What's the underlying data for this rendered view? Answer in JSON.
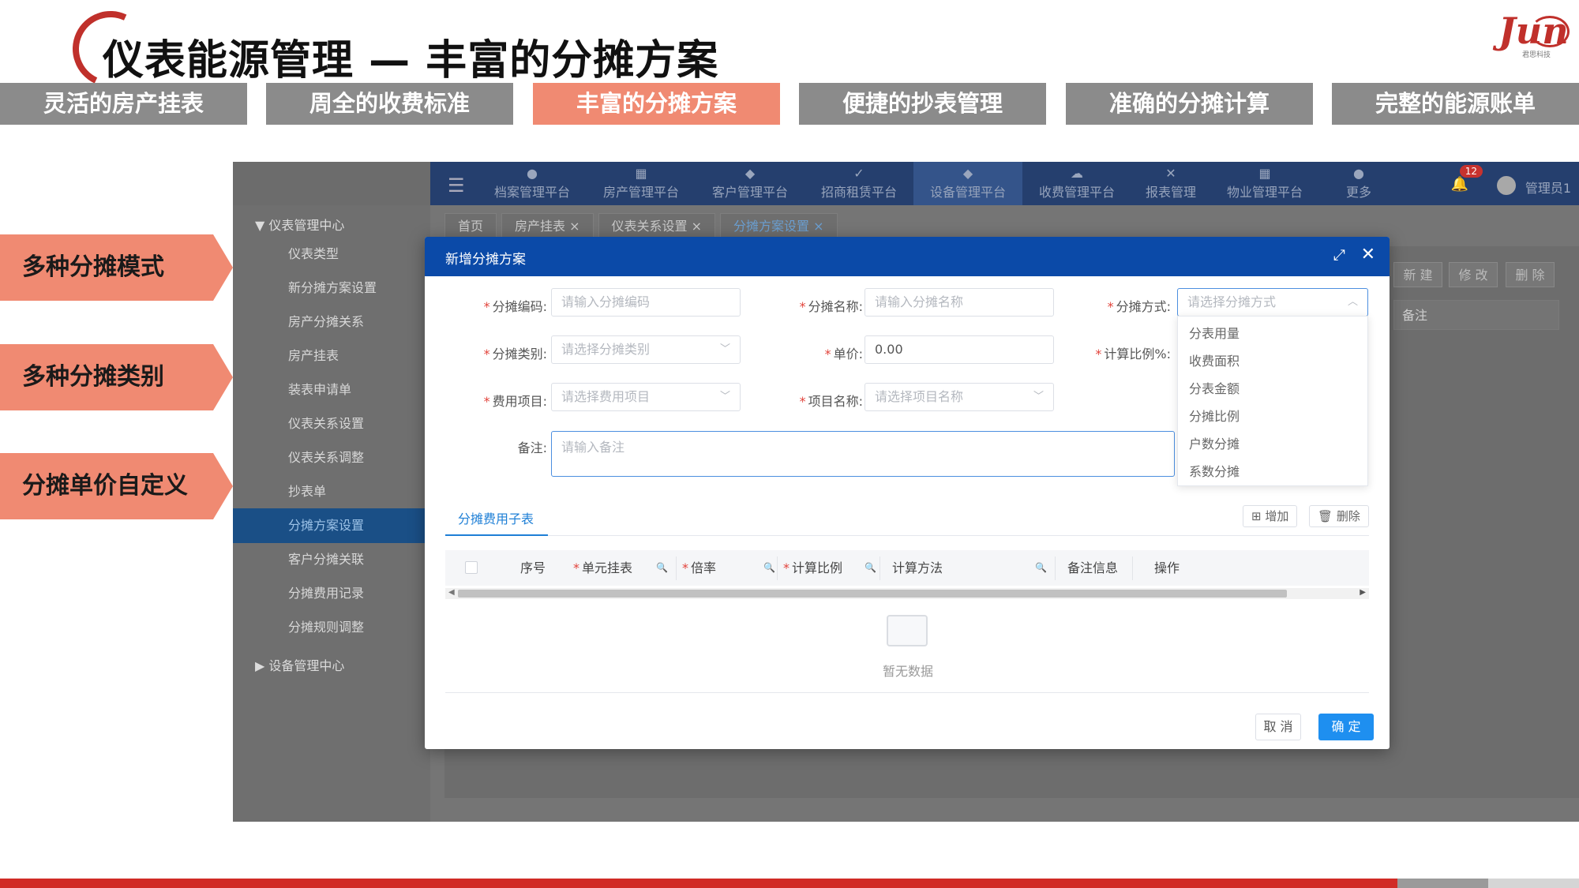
{
  "slide": {
    "title": "仪表能源管理 — 丰富的分摊方案",
    "logo_text": "Jun",
    "logo_sub": "君思科技",
    "nav": [
      {
        "label": "灵活的房产挂表"
      },
      {
        "label": "周全的收费标准"
      },
      {
        "label": "丰富的分摊方案",
        "active": true
      },
      {
        "label": "便捷的抄表管理"
      },
      {
        "label": "准确的分摊计算"
      },
      {
        "label": "完整的能源账单"
      }
    ],
    "callouts": [
      "多种分摊模式",
      "多种分摊类别",
      "分摊单价自定义"
    ],
    "colors": {
      "accent": "#f08a72",
      "tab_gray": "#8b8b8b",
      "brand_red": "#d12b26",
      "primary_blue": "#1e8ff0"
    }
  },
  "app": {
    "top_nav": [
      {
        "label": "档案管理平台",
        "icon": "archive-icon"
      },
      {
        "label": "房产管理平台",
        "icon": "building-icon"
      },
      {
        "label": "客户管理平台",
        "icon": "customer-icon"
      },
      {
        "label": "招商租赁平台",
        "icon": "check-icon"
      },
      {
        "label": "设备管理平台",
        "icon": "device-icon",
        "active": true
      },
      {
        "label": "收费管理平台",
        "icon": "charge-icon"
      },
      {
        "label": "报表管理",
        "icon": "report-icon"
      },
      {
        "label": "物业管理平台",
        "icon": "property-icon"
      },
      {
        "label": "更多",
        "icon": "more-icon"
      }
    ],
    "notification_count": "12",
    "user": "管理员1",
    "sidebar": {
      "group1": "仪表管理中心",
      "items": [
        "仪表类型",
        "新分摊方案设置",
        "房产分摊关系",
        "房产挂表",
        "装表申请单",
        "仪表关系设置",
        "仪表关系调整",
        "抄表单",
        "分摊方案设置",
        "客户分摊关联",
        "分摊费用记录",
        "分摊规则调整"
      ],
      "active_index": 8,
      "group2": "设备管理中心"
    },
    "tabs": [
      {
        "label": "首页"
      },
      {
        "label": "房产挂表 ×"
      },
      {
        "label": "仪表关系设置 ×"
      },
      {
        "label": "分摊方案设置 ×",
        "active": true
      }
    ],
    "bg_buttons": [
      "新 建",
      "修 改",
      "删 除"
    ],
    "bg_remark_label": "备注"
  },
  "modal": {
    "title": "新增分摊方案",
    "fields": {
      "code": {
        "label": "分摊编码:",
        "placeholder": "请输入分摊编码"
      },
      "name": {
        "label": "分摊名称:",
        "placeholder": "请输入分摊名称"
      },
      "method": {
        "label": "分摊方式:",
        "placeholder": "请选择分摊方式"
      },
      "category": {
        "label": "分摊类别:",
        "placeholder": "请选择分摊类别"
      },
      "price": {
        "label": "单价:",
        "value": "0.00"
      },
      "ratio": {
        "label": "计算比例%:"
      },
      "fee_item": {
        "label": "费用项目:",
        "placeholder": "请选择费用项目"
      },
      "project": {
        "label": "项目名称:",
        "placeholder": "请选择项目名称"
      },
      "remark": {
        "label": "备注:",
        "placeholder": "请输入备注"
      }
    },
    "method_options": [
      "分表用量",
      "收费面积",
      "分表金额",
      "分摊比例",
      "户数分摊",
      "系数分摊"
    ],
    "subtab": "分摊费用子表",
    "add_label": "增加",
    "delete_label": "删除",
    "columns": [
      {
        "label": "序号"
      },
      {
        "label": "单元挂表",
        "required": true
      },
      {
        "label": "倍率",
        "required": true
      },
      {
        "label": "计算比例",
        "required": true
      },
      {
        "label": "计算方法"
      },
      {
        "label": "备注信息"
      },
      {
        "label": "操作"
      }
    ],
    "empty_text": "暂无数据",
    "cancel_label": "取 消",
    "ok_label": "确 定"
  }
}
